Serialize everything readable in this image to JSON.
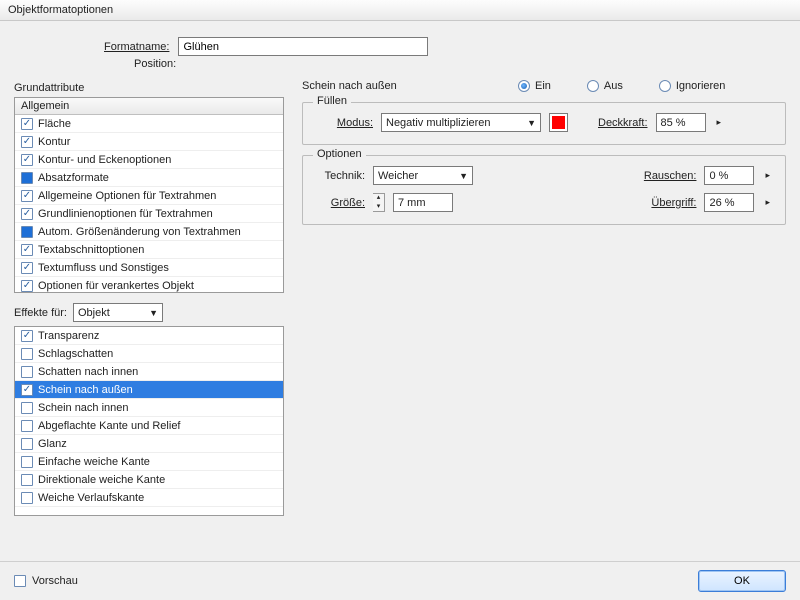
{
  "window": {
    "title": "Objektformatoptionen"
  },
  "header": {
    "formatname_label": "Formatname:",
    "formatname_value": "Glühen",
    "position_label": "Position:"
  },
  "left": {
    "grundattribute_title": "Grundattribute",
    "grundattribute_header": "Allgemein",
    "grund_items": [
      {
        "label": "Fläche",
        "state": "checked"
      },
      {
        "label": "Kontur",
        "state": "checked"
      },
      {
        "label": "Kontur- und Eckenoptionen",
        "state": "checked"
      },
      {
        "label": "Absatzformate",
        "state": "blue"
      },
      {
        "label": "Allgemeine Optionen für Textrahmen",
        "state": "checked"
      },
      {
        "label": "Grundlinienoptionen für Textrahmen",
        "state": "checked"
      },
      {
        "label": "Autom. Größenänderung von Textrahmen",
        "state": "blue"
      },
      {
        "label": "Textabschnittoptionen",
        "state": "checked"
      },
      {
        "label": "Textumfluss und Sonstiges",
        "state": "checked"
      },
      {
        "label": "Optionen für verankertes Objekt",
        "state": "checked"
      }
    ],
    "effects_label": "Effekte für:",
    "effects_target": "Objekt",
    "effects_items": [
      {
        "label": "Transparenz",
        "state": "checked"
      },
      {
        "label": "Schlagschatten",
        "state": "off"
      },
      {
        "label": "Schatten nach innen",
        "state": "off"
      },
      {
        "label": "Schein nach außen",
        "state": "checked",
        "selected": true
      },
      {
        "label": "Schein nach innen",
        "state": "off"
      },
      {
        "label": "Abgeflachte Kante und Relief",
        "state": "off"
      },
      {
        "label": "Glanz",
        "state": "off"
      },
      {
        "label": "Einfache weiche Kante",
        "state": "off"
      },
      {
        "label": "Direktionale weiche Kante",
        "state": "off"
      },
      {
        "label": "Weiche Verlaufskante",
        "state": "off"
      }
    ]
  },
  "right": {
    "title": "Schein nach außen",
    "radios": {
      "ein": "Ein",
      "aus": "Aus",
      "ign": "Ignorieren",
      "selected": "ein"
    },
    "fuellen": {
      "legend": "Füllen",
      "modus_label": "Modus:",
      "modus_value": "Negativ multiplizieren",
      "color": "#ff0000",
      "deckkraft_label": "Deckkraft:",
      "deckkraft_value": "85 %"
    },
    "optionen": {
      "legend": "Optionen",
      "technik_label": "Technik:",
      "technik_value": "Weicher",
      "groesse_label": "Größe:",
      "groesse_value": "7 mm",
      "rauschen_label": "Rauschen:",
      "rauschen_value": "0 %",
      "uebergriff_label": "Übergriff:",
      "uebergriff_value": "26 %"
    }
  },
  "footer": {
    "vorschau_label": "Vorschau",
    "ok_label": "OK"
  }
}
